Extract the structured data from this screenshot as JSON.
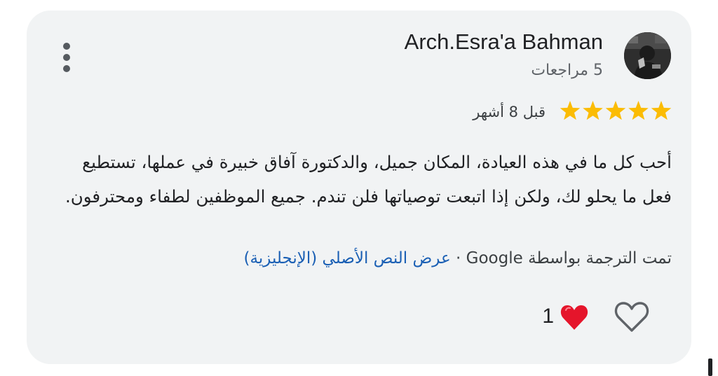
{
  "reviewer": {
    "name": "Arch.Esra'a Bahman",
    "review_count": "5 مراجعات"
  },
  "review": {
    "rating": 5,
    "rating_max": 5,
    "star_color": "#fbbc04",
    "time_ago": "قبل 8 أشهر",
    "text": "أحب كل ما في هذه العيادة، المكان جميل، والدكتورة آفاق خبيرة في عملها، تستطيع فعل ما يحلو لك، ولكن إذا اتبعت توصياتها فلن تندم. جميع الموظفين لطفاء ومحترفون.",
    "translated_by": "تمت الترجمة بواسطة Google",
    "separator": "·",
    "show_original": "عرض النص الأصلي (الإنجليزية)"
  },
  "actions": {
    "reaction_count": "1",
    "menu_icon": "more-vert-icon",
    "like_icon": "heart-outline-icon",
    "reaction_icon": "red-heart-icon"
  },
  "colors": {
    "card_background": "#f1f3f4",
    "link": "#1a5fb4",
    "heart_red": "#e5152b"
  }
}
